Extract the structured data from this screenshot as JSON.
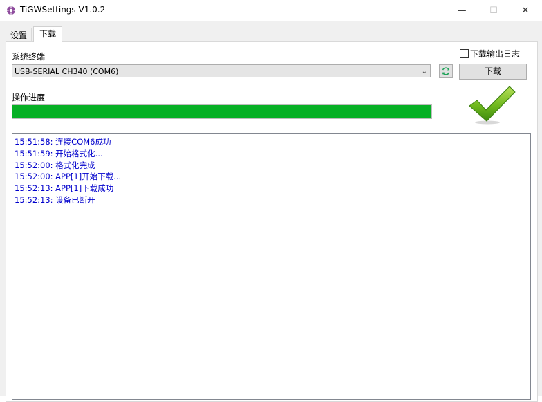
{
  "window": {
    "title": "TiGWSettings V1.0.2",
    "min_glyph": "—",
    "max_glyph": "☐",
    "close_glyph": "✕"
  },
  "tabs": [
    {
      "label": "设置",
      "active": false
    },
    {
      "label": "下载",
      "active": true
    }
  ],
  "download": {
    "terminal_label": "系统终端",
    "port_selected": "USB-SERIAL CH340 (COM6)",
    "log_checkbox_label": "下载输出日志",
    "log_checked": false,
    "download_button": "下载",
    "progress_label": "操作进度",
    "progress_percent": 100,
    "progress_color": "#06b025",
    "status_icon": "success-checkmark-icon"
  },
  "log": [
    "15:51:58: 连接COM6成功",
    "15:51:59: 开始格式化...",
    "15:52:00: 格式化完成",
    "15:52:00: APP[1]开始下载...",
    "15:52:13: APP[1]下载成功",
    "15:52:13: 设备已断开"
  ]
}
